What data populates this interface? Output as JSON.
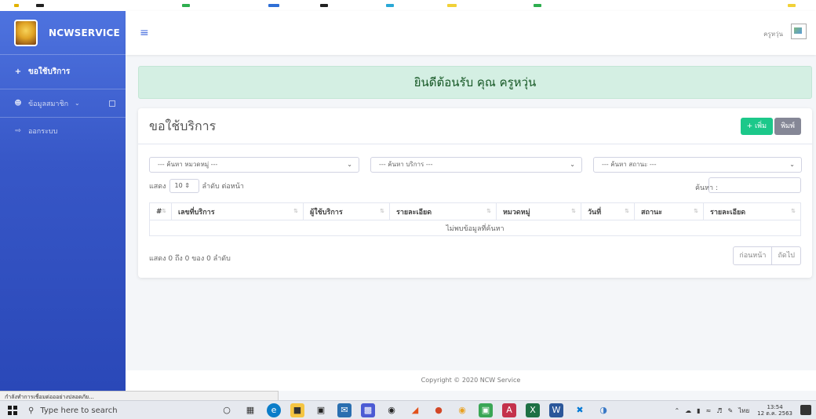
{
  "brand": {
    "name": "NCWSERVICE"
  },
  "sidebar": {
    "items": [
      {
        "label": "ขอใช้บริการ",
        "icon": "plus-icon"
      },
      {
        "label": "ข้อมูลสมาชิก",
        "icon": "user-icon"
      },
      {
        "label": "ออกระบบ",
        "icon": "logout-icon"
      }
    ]
  },
  "topbar": {
    "username": "ครูหวุ่น"
  },
  "alert": {
    "welcome": "ยินดีต้อนรับ คุณ ครูหวุ่น"
  },
  "card": {
    "title": "ขอใช้บริการ",
    "add_label": "+ เพิ่ม",
    "print_label": "พิมพ์"
  },
  "filters": {
    "category": "--- ค้นหา หมวดหมู่ ---",
    "service": "--- ค้นหา บริการ ---",
    "status": "--- ค้นหา สถานะ ---"
  },
  "length": {
    "prefix": "แสดง",
    "value": "10",
    "suffix": "ลำดับ ต่อหน้า"
  },
  "search": {
    "label": "ค้นหา :"
  },
  "table": {
    "columns": [
      "#",
      "เลขที่บริการ",
      "ผู้ใช้บริการ",
      "รายละเอียด",
      "หมวดหมู่",
      "วันที่",
      "สถานะ",
      "รายละเอียด"
    ],
    "empty": "ไม่พบข้อมูลที่ค้นหา"
  },
  "pagination": {
    "info": "แสดง 0 ถึง 0 ของ 0 ลำดับ",
    "prev": "ก่อนหน้า",
    "next": "ถัดไป"
  },
  "footer": {
    "text": "Copyright © 2020 NCW Service"
  },
  "browser_status": {
    "text": "กำลังทำการเชื่อมต่อออย่างปลอดภัย..."
  },
  "taskbar": {
    "search_placeholder": "Type here to search",
    "lang": "ไทย",
    "time": "13:54",
    "date": "12 ต.ค. 2563"
  },
  "colors": {
    "sidebar": "#4e73df",
    "success": "#1cc88a",
    "secondary": "#858796",
    "alert_bg": "#d4efe3"
  }
}
